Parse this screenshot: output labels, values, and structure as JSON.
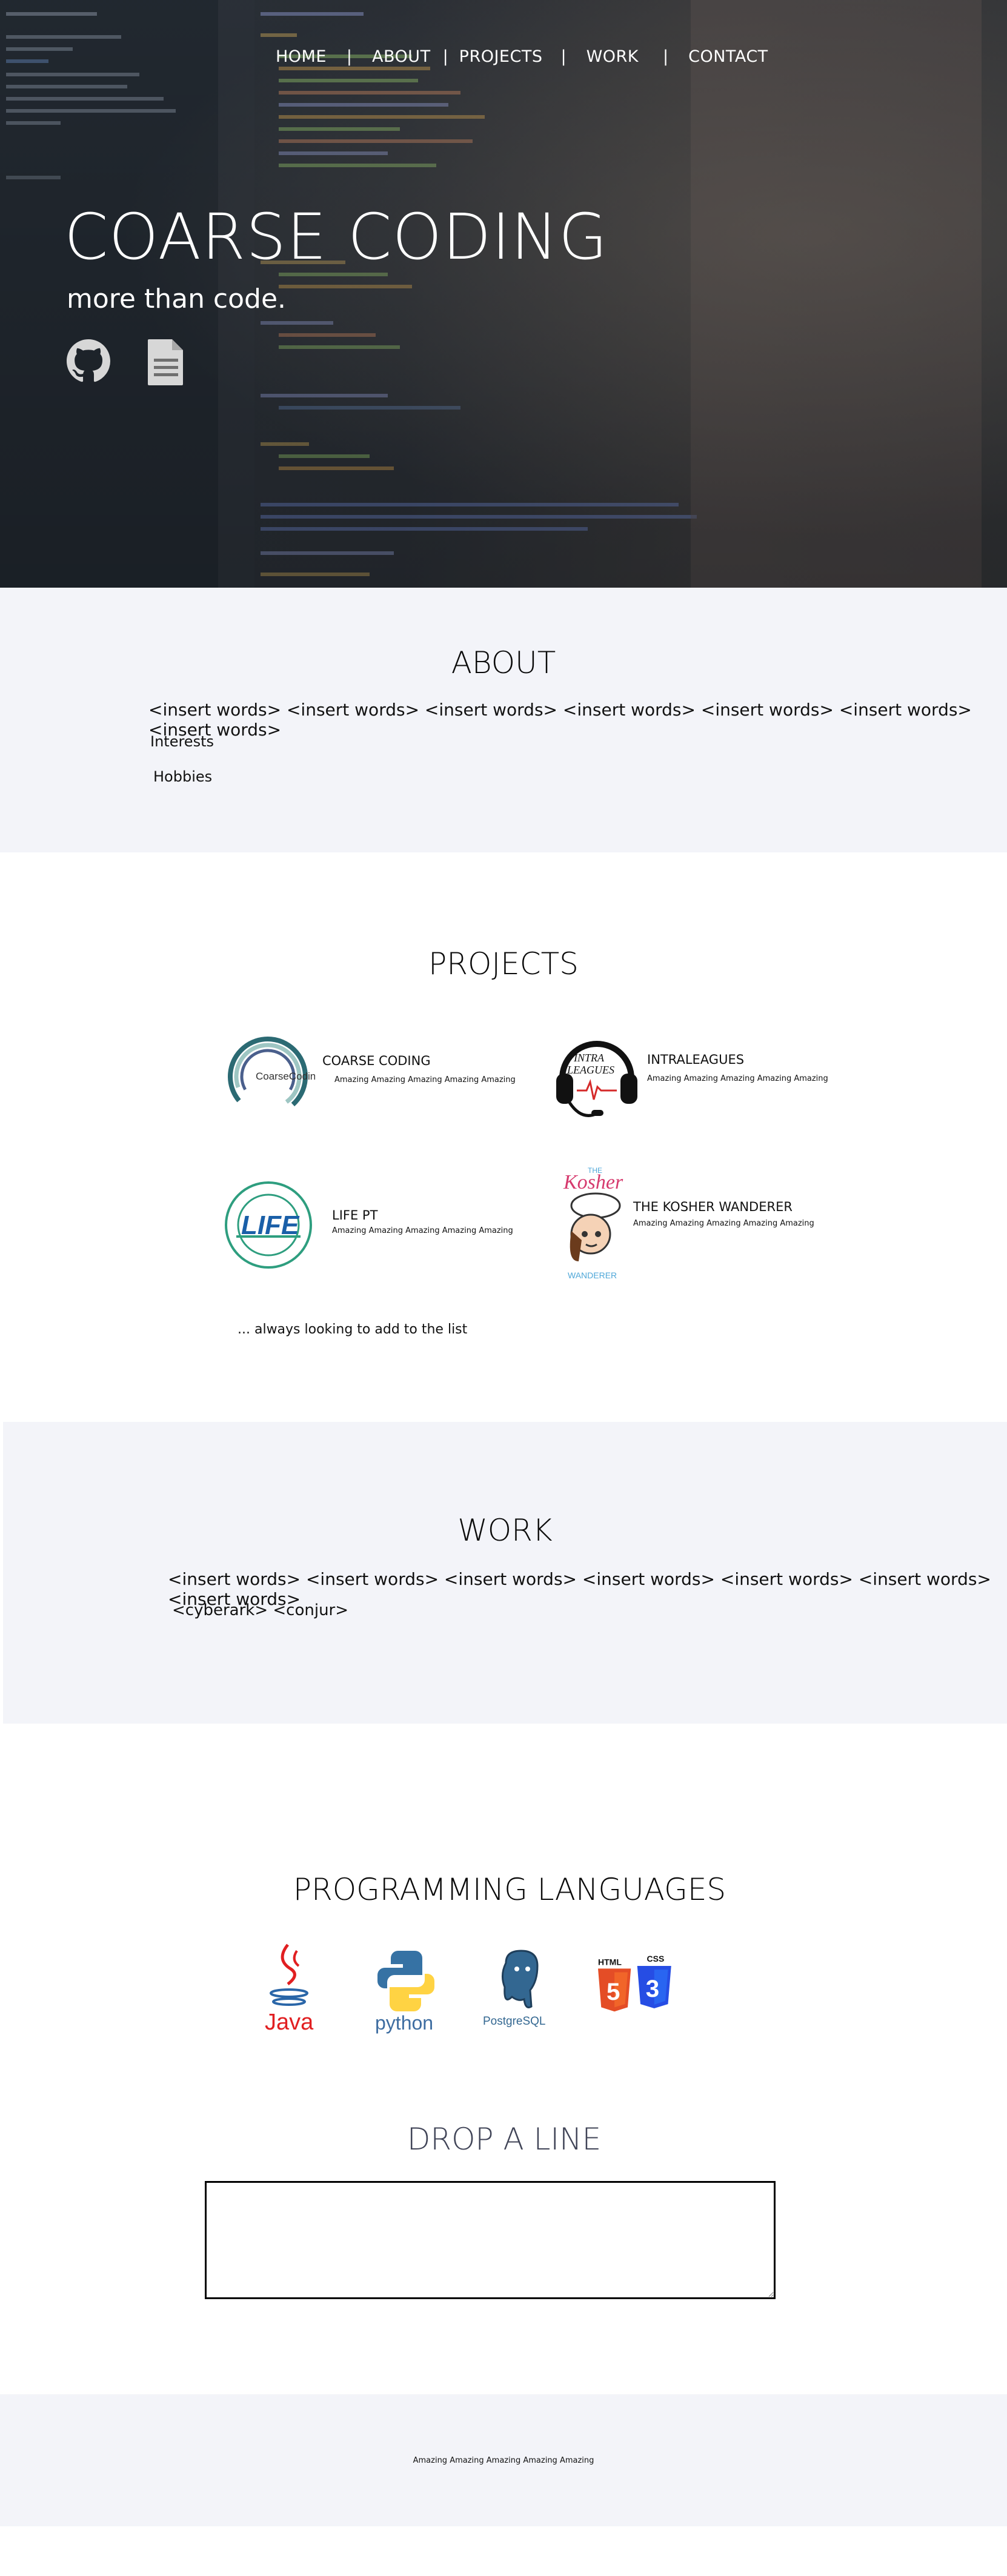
{
  "nav": {
    "items": [
      "HOME",
      "ABOUT",
      "PROJECTS",
      "WORK",
      "CONTACT"
    ],
    "separator": "|"
  },
  "hero": {
    "title": "COARSE CODING",
    "subtitle": "more than code.",
    "icons": [
      "github-icon",
      "document-icon"
    ]
  },
  "about": {
    "title": "ABOUT",
    "words": "<insert words> <insert words> <insert words> <insert words> <insert words> <insert words> <insert words>",
    "interests": "Interests",
    "hobbies": "Hobbies"
  },
  "projects": {
    "title": "PROJECTS",
    "items": [
      {
        "name": "COARSE CODING",
        "desc": "Amazing Amazing Amazing Amazing Amazing",
        "logo_text": "CoarseCoding"
      },
      {
        "name": "INTRALEAGUES",
        "desc": "Amazing Amazing Amazing Amazing Amazing",
        "logo_text": "INTRA LEAGUES"
      },
      {
        "name": "LIFE PT",
        "desc": "Amazing Amazing Amazing Amazing Amazing",
        "logo_text": "LIFE"
      },
      {
        "name": "THE KOSHER WANDERER",
        "desc": "Amazing Amazing Amazing Amazing Amazing",
        "logo_text": "Kosher"
      }
    ],
    "footer_note": "... always looking to add to the list"
  },
  "work": {
    "title": "WORK",
    "words": "<insert words> <insert words> <insert words> <insert words> <insert words> <insert words> <insert words>",
    "companies": "<cyberark> <conjur>"
  },
  "languages": {
    "title": "PROGRAMMING LANGUAGES",
    "items": [
      "Java",
      "python",
      "PostgreSQL",
      "HTML",
      "CSS"
    ]
  },
  "contact": {
    "title": "DROP A LINE"
  },
  "footer": {
    "text": "Amazing Amazing Amazing Amazing Amazing"
  },
  "colors": {
    "section_bg": "#f3f4f9",
    "contact_title": "#404457",
    "java_red": "#e11f21",
    "python_blue": "#3672a4",
    "python_yellow": "#ffd343",
    "postgres_blue": "#336791",
    "html_orange": "#e44d26",
    "css_blue": "#264de4"
  }
}
